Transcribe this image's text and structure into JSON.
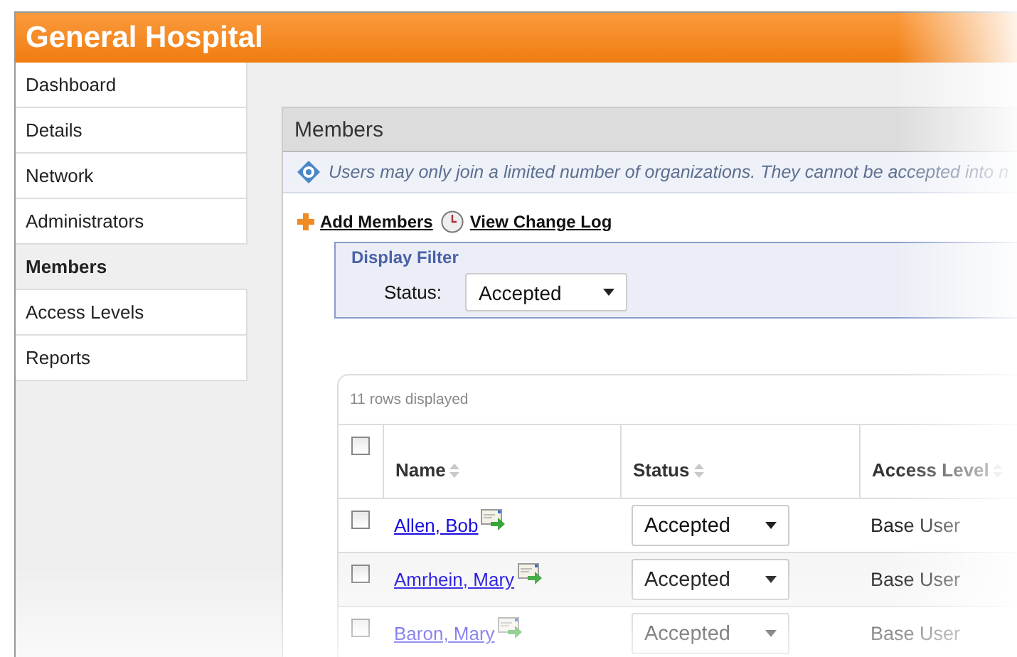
{
  "header": {
    "title": "General Hospital"
  },
  "sidebar": {
    "items": [
      {
        "label": "Dashboard",
        "selected": false
      },
      {
        "label": "Details",
        "selected": false
      },
      {
        "label": "Network",
        "selected": false
      },
      {
        "label": "Administrators",
        "selected": false
      },
      {
        "label": "Members",
        "selected": true
      },
      {
        "label": "Access Levels",
        "selected": false
      },
      {
        "label": "Reports",
        "selected": false
      }
    ]
  },
  "panel": {
    "title": "Members",
    "info": "Users may only join a limited number of organizations. They cannot be accepted into n",
    "actions": [
      {
        "kind": "add",
        "label": "Add Members"
      },
      {
        "kind": "log",
        "label": "View Change Log"
      }
    ],
    "filter": {
      "title": "Display Filter",
      "label": "Status:",
      "value": "Accepted"
    }
  },
  "table": {
    "caption": "11 rows displayed",
    "select_all": {
      "checked": false
    },
    "columns": [
      "Name",
      "Status",
      "Access Level"
    ],
    "rows": [
      {
        "checked": false,
        "name": "Allen, Bob",
        "status": "Accepted",
        "access_level": "Base User"
      },
      {
        "checked": false,
        "name": "Amrhein, Mary",
        "status": "Accepted",
        "access_level": "Base User"
      },
      {
        "checked": false,
        "name": "Baron, Mary",
        "status": "Accepted",
        "access_level": "Base User"
      }
    ]
  }
}
